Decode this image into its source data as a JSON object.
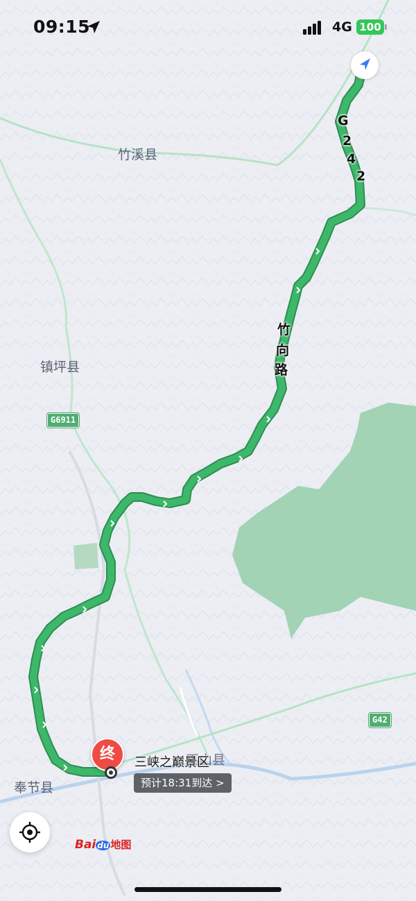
{
  "status_bar": {
    "time": "09:15",
    "network": "4G",
    "battery": "100"
  },
  "map": {
    "place_labels": {
      "zhuxi": "竹溪县",
      "zhenping": "镇坪县",
      "wushan": "巫山县",
      "fengjie": "奉节县"
    },
    "highway_shields": {
      "g6911": "G6911",
      "g42": "G42"
    },
    "road_labels": {
      "g242": [
        "G",
        "2",
        "4",
        "2"
      ],
      "zhuxiang": [
        "竹",
        "向",
        "路"
      ]
    },
    "colors": {
      "route": "#3db86a",
      "route_border": "#2e8d52",
      "forest": "#8fcca4",
      "land": "#eceef4",
      "major_road": "#b6e3c4"
    }
  },
  "destination": {
    "pin_label": "终",
    "name": "三峡之巅景区",
    "eta": "预计18:31到达 >"
  },
  "logo": {
    "bai": "Bai",
    "du": "du",
    "cn": "地图"
  }
}
